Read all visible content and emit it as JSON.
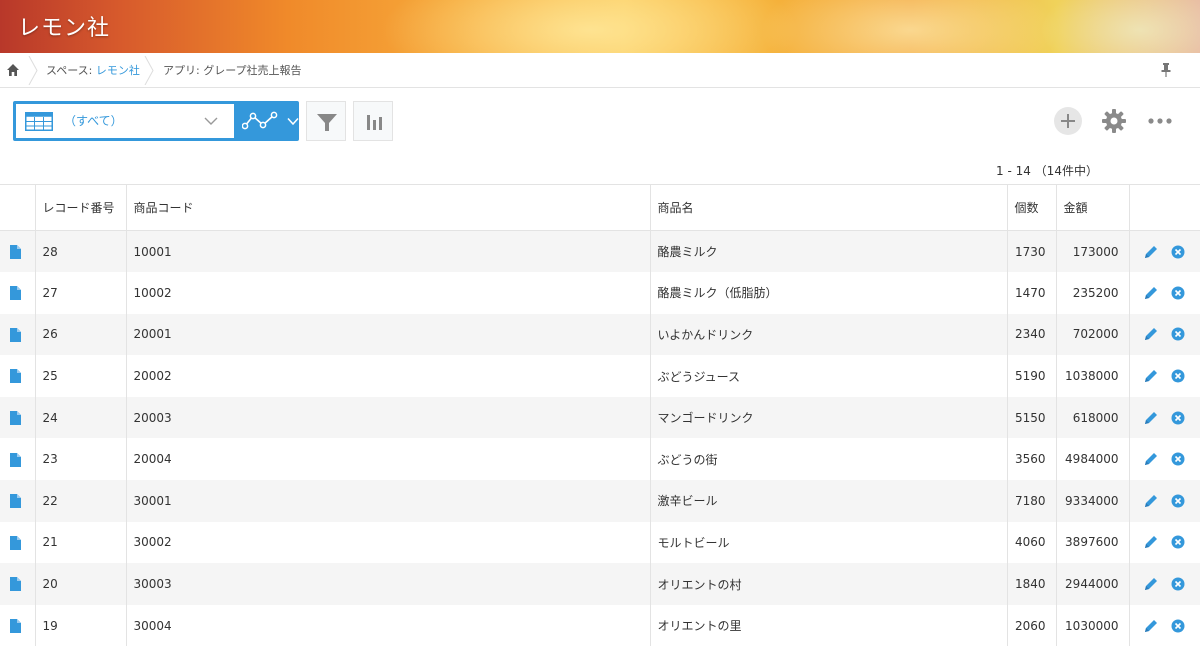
{
  "app": {
    "space_title": "レモン社"
  },
  "breadcrumb": {
    "space_prefix": "スペース: ",
    "space_link": "レモン社",
    "app_label": "アプリ: グレープ社売上報告"
  },
  "toolbar": {
    "view_label": "（すべて）",
    "pager": "1 - 14 （14件中）"
  },
  "table": {
    "headers": {
      "record_no": "レコード番号",
      "product_code": "商品コード",
      "product_name": "商品名",
      "qty": "個数",
      "amount": "金額"
    },
    "rows": [
      {
        "record_no": "28",
        "product_code": "10001",
        "product_name": "酪農ミルク",
        "qty": "1730",
        "amount": "173000"
      },
      {
        "record_no": "27",
        "product_code": "10002",
        "product_name": "酪農ミルク（低脂肪）",
        "qty": "1470",
        "amount": "235200"
      },
      {
        "record_no": "26",
        "product_code": "20001",
        "product_name": "いよかんドリンク",
        "qty": "2340",
        "amount": "702000"
      },
      {
        "record_no": "25",
        "product_code": "20002",
        "product_name": "ぶどうジュース",
        "qty": "5190",
        "amount": "1038000"
      },
      {
        "record_no": "24",
        "product_code": "20003",
        "product_name": "マンゴードリンク",
        "qty": "5150",
        "amount": "618000"
      },
      {
        "record_no": "23",
        "product_code": "20004",
        "product_name": "ぶどうの街",
        "qty": "3560",
        "amount": "4984000"
      },
      {
        "record_no": "22",
        "product_code": "30001",
        "product_name": "激辛ビール",
        "qty": "7180",
        "amount": "9334000"
      },
      {
        "record_no": "21",
        "product_code": "30002",
        "product_name": "モルトビール",
        "qty": "4060",
        "amount": "3897600"
      },
      {
        "record_no": "20",
        "product_code": "30003",
        "product_name": "オリエントの村",
        "qty": "1840",
        "amount": "2944000"
      },
      {
        "record_no": "19",
        "product_code": "30004",
        "product_name": "オリエントの里",
        "qty": "2060",
        "amount": "1030000"
      }
    ]
  },
  "colors": {
    "accent": "#3498db",
    "row_alt": "#f5f5f5",
    "delete_icon": "#3498db"
  },
  "icons": {
    "home": "home-icon",
    "pin": "pin-icon",
    "table": "table-view-icon",
    "graph": "graph-icon",
    "filter": "filter-icon",
    "chart": "bar-chart-icon",
    "add": "add-icon",
    "settings": "gear-icon",
    "more": "more-icon",
    "record": "document-icon",
    "edit": "pencil-icon",
    "delete": "delete-icon"
  }
}
